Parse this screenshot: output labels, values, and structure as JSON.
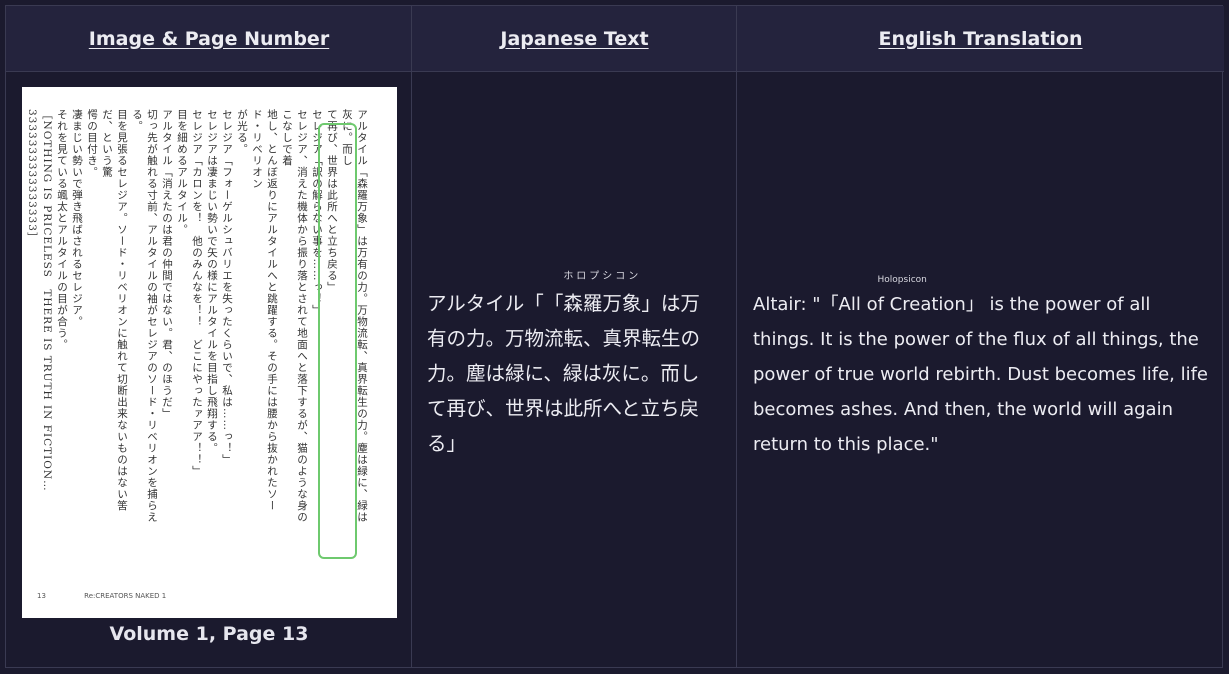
{
  "headers": {
    "image_page": "Image & Page Number",
    "japanese": "Japanese Text",
    "english": "English Translation"
  },
  "page_image": {
    "columns": [
      "アルタイル「森羅万象」は万有の力。万物流転、真界転生の力。塵は緑に、緑は灰に。而し",
      "て再び、世界は此所へと立ち戻る」",
      "セレジア「訳の解らない事を……っ！」",
      "セレジア、消えた機体から振り落とされて地面へと落下するが、猫のような身のこなしで着",
      "地し、とんぼ返りにアルタイルへと跳躍する。その手には腰から抜かれたソード・リベリオン",
      "が光る。",
      "セレジア「フォーゲルシュバリエを失ったくらいで、私は……っ！」",
      "セレジアは凄まじい勢いで矢の様にアルタイルを目指し飛翔する。",
      "セレジア「カロンを！　他のみんなを！！　どこにやったァアア！！」",
      "目を細めるアルタイル。",
      "アルタイル「消えたのは君の仲間ではない。君、のほうだ」",
      "切っ先が触れる寸前、アルタイルの袖がセレジアのソード・リベリオンを捕らえる。",
      "目を見張るセレジア。ソード・リベリオンに触れて切断出来ないものはない筈だ、という驚",
      "愕の目付き。",
      "凄まじい勢いで弾き飛ばされるセレジア。",
      "それを見ている颯太とアルタイルの目が合う。",
      "［NOTHING IS PRICELESS　THERE IS TRUTH IN FICTION…3333333333333333］"
    ],
    "footer_page": "13",
    "footer_title": "Re:CREATORS NAKED 1"
  },
  "caption": "Volume 1, Page 13",
  "japanese": {
    "before": "アルタイル「",
    "term": "「森羅万象」",
    "ruby": "ホロプシコン",
    "after": "は万有の力。万物流転、真界転生の力。塵は緑に、緑は灰に。而して再び、世界は此所へと立ち戻る」"
  },
  "english": {
    "before": "Altair: \"",
    "term": "「All of Creation」",
    "ruby": "Holopsicon",
    "after": " is the power of all things. It is the power of the flux of all things, the power of true world rebirth. Dust becomes life, life becomes ashes. And then, the world will again return to this place.\""
  }
}
